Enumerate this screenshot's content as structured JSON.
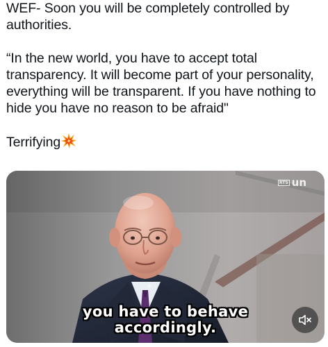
{
  "post": {
    "lines": [
      "WEF- Soon you will be completely controlled by",
      "authorities.",
      "“In the new world, you have to accept total",
      "transparency. It will become part of your personality,",
      "everything will be transparent. If you have nothing to",
      "hide you have no reason to be afraid\""
    ],
    "closing": "Terrifying",
    "closing_emoji": "collision-emoji"
  },
  "video": {
    "caption_line1": "you have to behave",
    "caption_line2": "accordingly.",
    "broadcaster_badge": "RTS",
    "broadcaster_logo": "un",
    "mute_icon": "speaker-muted-icon"
  }
}
